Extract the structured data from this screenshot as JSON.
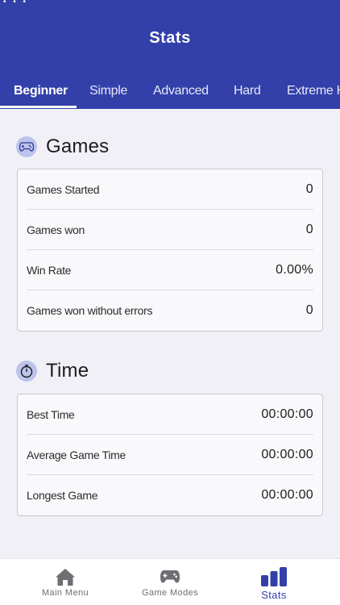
{
  "header": {
    "title": "Stats",
    "status_dots": "• • •"
  },
  "tabs": [
    {
      "label": "Beginner",
      "active": true
    },
    {
      "label": "Simple",
      "active": false
    },
    {
      "label": "Advanced",
      "active": false
    },
    {
      "label": "Hard",
      "active": false
    },
    {
      "label": "Extreme Ha",
      "active": false
    }
  ],
  "games": {
    "title": "Games",
    "icon": "gamepad-icon",
    "rows": [
      {
        "label": "Games Started",
        "value": "0"
      },
      {
        "label": "Games won",
        "value": "0"
      },
      {
        "label": "Win Rate",
        "value": "0.00%"
      },
      {
        "label": "Games won without errors",
        "value": "0"
      }
    ]
  },
  "time": {
    "title": "Time",
    "icon": "stopwatch-icon",
    "rows": [
      {
        "label": "Best Time",
        "value": "00:00:00"
      },
      {
        "label": "Average Game Time",
        "value": "00:00:00"
      },
      {
        "label": "Longest Game",
        "value": "00:00:00"
      }
    ]
  },
  "nav": {
    "items": [
      {
        "label": "Main Menu",
        "icon": "home-icon",
        "active": false
      },
      {
        "label": "Game Modes",
        "icon": "gamepad-icon",
        "active": false
      },
      {
        "label": "Stats",
        "icon": "bar-chart-icon",
        "active": true
      }
    ]
  },
  "colors": {
    "primary": "#3340a9",
    "background": "#f1f0f6",
    "icon_circle": "#bcc4ec",
    "nav_inactive": "#6e6e73"
  }
}
